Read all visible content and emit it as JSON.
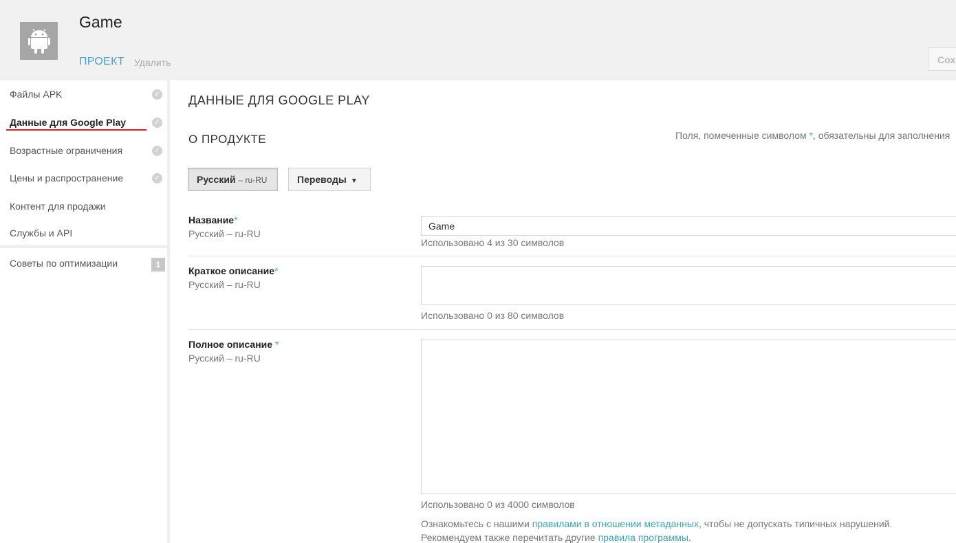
{
  "app": {
    "name": "Game"
  },
  "header": {
    "tab_project": "ПРОЕКТ",
    "tab_delete": "Удалить",
    "save_label": "Сохранить"
  },
  "sidebar": {
    "items": [
      {
        "label": "Файлы APK",
        "check": "✓"
      },
      {
        "label": "Данные для Google Play",
        "check": "✓"
      },
      {
        "label": "Возрастные ограничения",
        "check": "✓"
      },
      {
        "label": "Цены и распространение",
        "check": "✓"
      },
      {
        "label": "Контент для продажи"
      },
      {
        "label": "Службы и API"
      }
    ],
    "tips": {
      "label": "Советы по оптимизации",
      "badge": "1"
    }
  },
  "main": {
    "page_title": "ДАННЫЕ ДЛЯ GOOGLE PLAY",
    "section_title": "О ПРОДУКТЕ",
    "required_note_pre": "Поля, помеченные символом ",
    "required_note_star": "*",
    "required_note_post": ", обязательны для заполнения",
    "lang_button": {
      "name": "Русский",
      "code": "– ru-RU"
    },
    "translations_button": "Переводы",
    "caret": "▼",
    "fields": {
      "title": {
        "label": "Название",
        "star": "*",
        "lang": "Русский – ru-RU",
        "value": "Game",
        "counter": "Использовано 4 из 30 символов"
      },
      "short_desc": {
        "label": "Краткое описание",
        "star": "*",
        "lang": "Русский – ru-RU",
        "value": "",
        "counter": "Использовано 0 из 80 символов"
      },
      "full_desc": {
        "label": "Полное описание",
        "star": " *",
        "lang": "Русский – ru-RU",
        "value": "",
        "counter": "Использовано 0 из 4000 символов"
      }
    },
    "footer": {
      "line1_pre": "Ознакомьтесь с нашими ",
      "line1_link": "правилами в отношении метаданных",
      "line1_post": ", чтобы не допускать типичных нарушений.",
      "line2_pre": "Рекомендуем также перечитать другие ",
      "line2_link": "правила программы",
      "line2_post": "."
    }
  }
}
